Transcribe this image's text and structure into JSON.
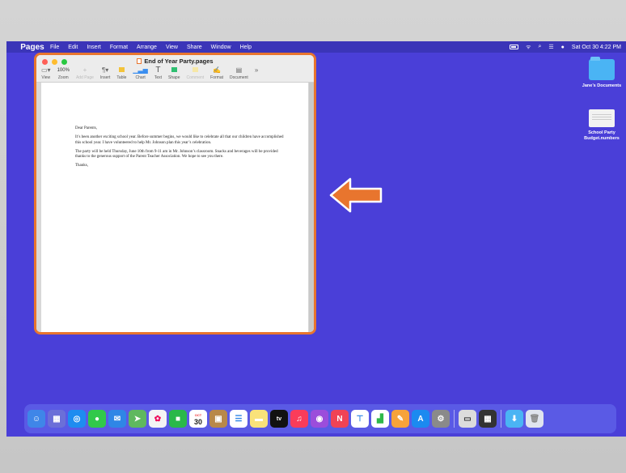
{
  "menubar": {
    "app_name": "Pages",
    "items": [
      "File",
      "Edit",
      "Insert",
      "Format",
      "Arrange",
      "View",
      "Share",
      "Window",
      "Help"
    ],
    "clock": "Sat Oct 30  4:22 PM"
  },
  "window": {
    "title": "End of Year Party.pages",
    "toolbar": {
      "view": "View",
      "zoom_value": "100%",
      "zoom": "Zoom",
      "add_page": "Add Page",
      "insert": "Insert",
      "table": "Table",
      "chart": "Chart",
      "text": "Text",
      "shape": "Shape",
      "comment": "Comment",
      "format": "Format",
      "document": "Document",
      "more": "»"
    }
  },
  "document": {
    "greeting": "Dear Parents,",
    "para1": "It’s been another exciting school year. Before summer begins, we would like to celebrate all that our children have accomplished this school year. I have volunteered to help Mr. Johnson plan this year’s celebration.",
    "para2": "The party will be held Thursday, June 10th from 9-11 am in Mr. Johnson’s classroom. Snacks and beverages will be provided thanks to the generous support of the Parent Teacher Association. We hope to see you there.",
    "closing": "Thanks,"
  },
  "desktop": {
    "folder_label": "Jane’s Documents",
    "file_label_1": "School Party",
    "file_label_2": "Budget.numbers"
  },
  "calendar": {
    "month": "OCT",
    "day": "30"
  },
  "colors": {
    "desktop": "#4a3fd8",
    "highlight": "#e8752e"
  }
}
